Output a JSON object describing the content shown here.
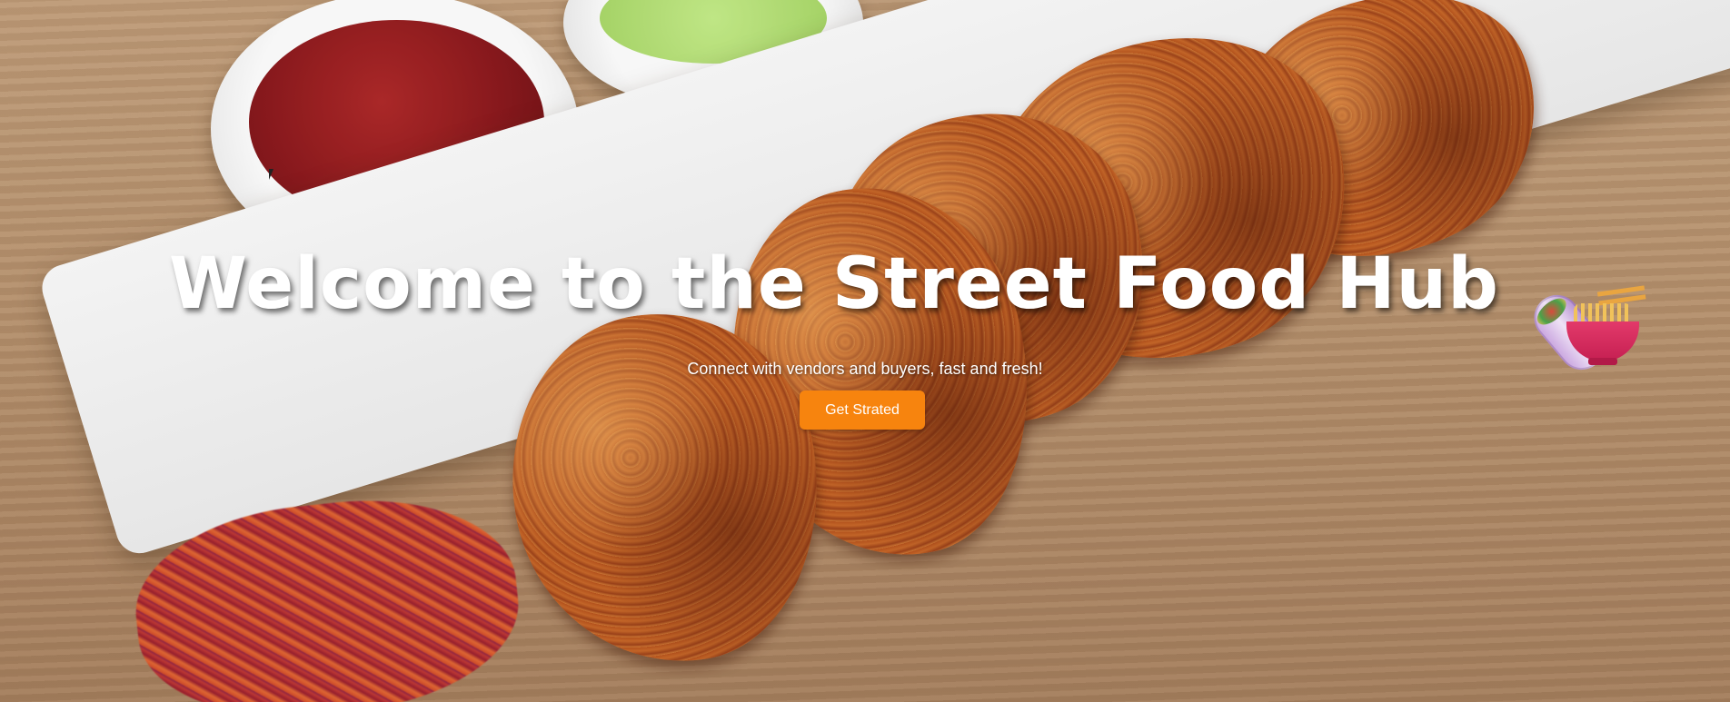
{
  "hero": {
    "title": "Welcome to the Street Food Hub",
    "title_emojis": [
      "burrito-icon",
      "ramen-bowl-icon"
    ],
    "subtitle": "Connect with vendors and buyers, fast and fresh!",
    "cta_label": "Get Strated"
  },
  "colors": {
    "cta_background": "#f7840e",
    "title_text": "#ffffff"
  }
}
